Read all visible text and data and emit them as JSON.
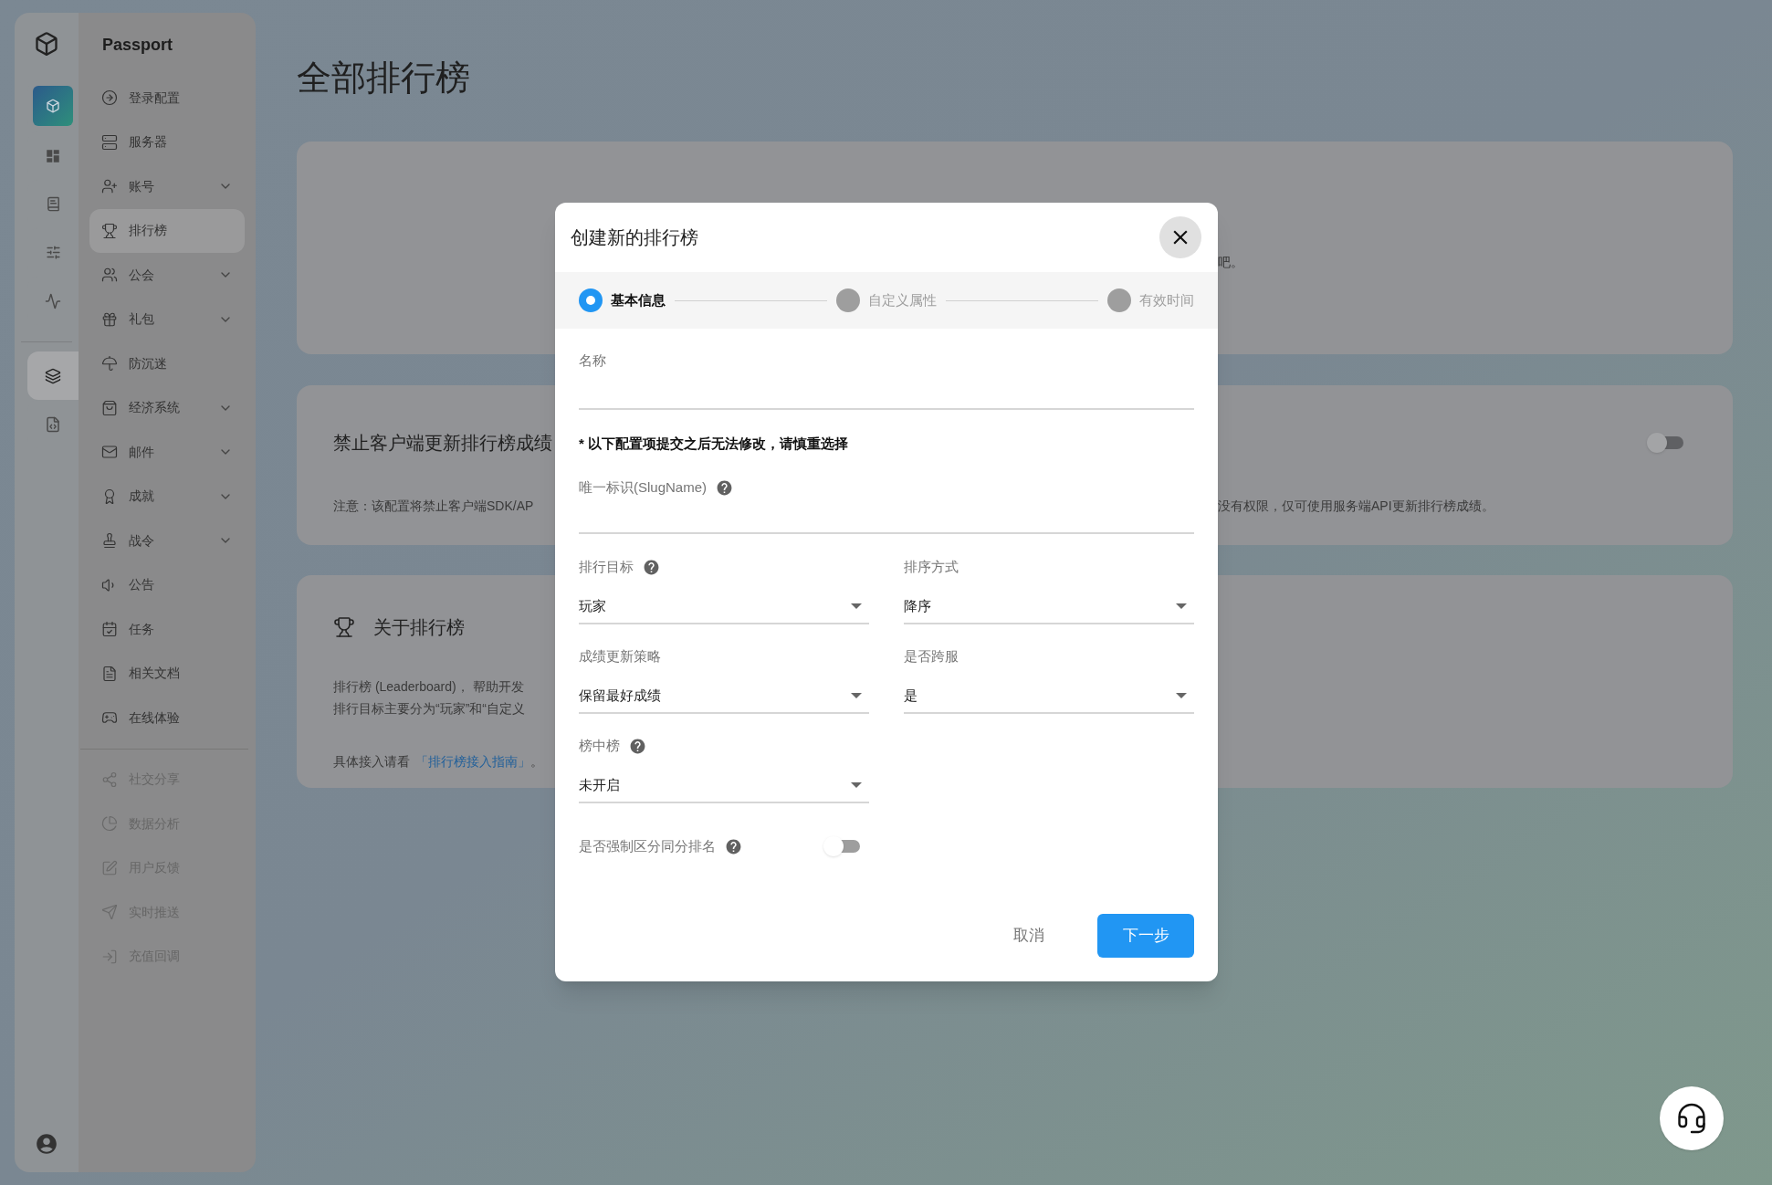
{
  "rail": {
    "items": [
      {
        "kind": "app",
        "selected": false
      },
      {
        "kind": "dashboard",
        "selected": false
      },
      {
        "kind": "docs",
        "selected": false
      },
      {
        "kind": "sliders",
        "selected": false
      },
      {
        "kind": "monitor",
        "selected": false
      },
      {
        "kind": "layers",
        "selected": true
      },
      {
        "kind": "code",
        "selected": false
      }
    ]
  },
  "sidebar": {
    "title": "Passport",
    "sections": [
      {
        "items": [
          {
            "label": "登录配置",
            "selected": false,
            "expandable": false,
            "disabled": false
          },
          {
            "label": "服务器",
            "selected": false,
            "expandable": false,
            "disabled": false
          },
          {
            "label": "账号",
            "selected": false,
            "expandable": true,
            "disabled": false
          },
          {
            "label": "排行榜",
            "selected": true,
            "expandable": false,
            "disabled": false
          },
          {
            "label": "公会",
            "selected": false,
            "expandable": true,
            "disabled": false
          },
          {
            "label": "礼包",
            "selected": false,
            "expandable": true,
            "disabled": false
          },
          {
            "label": "防沉迷",
            "selected": false,
            "expandable": false,
            "disabled": false
          },
          {
            "label": "经济系统",
            "selected": false,
            "expandable": true,
            "disabled": false
          },
          {
            "label": "邮件",
            "selected": false,
            "expandable": true,
            "disabled": false
          },
          {
            "label": "成就",
            "selected": false,
            "expandable": true,
            "disabled": false
          },
          {
            "label": "战令",
            "selected": false,
            "expandable": true,
            "disabled": false
          },
          {
            "label": "公告",
            "selected": false,
            "expandable": false,
            "disabled": false
          },
          {
            "label": "任务",
            "selected": false,
            "expandable": false,
            "disabled": false
          },
          {
            "label": "相关文档",
            "selected": false,
            "expandable": false,
            "disabled": false
          },
          {
            "label": "在线体验",
            "selected": false,
            "expandable": false,
            "disabled": false
          }
        ]
      },
      {
        "items": [
          {
            "label": "社交分享",
            "selected": false,
            "expandable": false,
            "disabled": true
          },
          {
            "label": "数据分析",
            "selected": false,
            "expandable": false,
            "disabled": true
          },
          {
            "label": "用户反馈",
            "selected": false,
            "expandable": false,
            "disabled": true
          },
          {
            "label": "实时推送",
            "selected": false,
            "expandable": false,
            "disabled": true
          },
          {
            "label": "充值回调",
            "selected": false,
            "expandable": false,
            "disabled": true
          }
        ]
      }
    ]
  },
  "page_title": "全部排行榜",
  "intro_card": {
    "text_right": "吧。"
  },
  "client_update_card": {
    "title": "禁止客户端更新排行榜成绩",
    "toggle": {
      "on": false
    },
    "note_left": "注意：该配置将禁止客户端SDK/AP",
    "note_right": "没有权限，仅可使用服务端API更新排行榜成绩。"
  },
  "about_card": {
    "title": "关于排行榜",
    "lines": [
      "排行榜 (Leaderboard)， 帮助开发",
      "排行目标主要分为“玩家”和“自定义"
    ],
    "guide_prefix": "具体接入请看",
    "guide_link": "「排行榜接入指南」",
    "guide_suffix": "。"
  },
  "dialog": {
    "title": "创建新的排行榜",
    "steps": [
      {
        "label": "基本信息",
        "selected": true
      },
      {
        "label": "自定义属性",
        "selected": false
      },
      {
        "label": "有效时间",
        "selected": false
      }
    ],
    "name_field": {
      "label": "名称"
    },
    "warning": "* 以下配置项提交之后无法修改，请慎重选择",
    "slug_field": {
      "label": "唯一标识(SlugName)",
      "help": true
    },
    "selects": [
      {
        "label": "排行目标",
        "value": "玩家",
        "help": true
      },
      {
        "label": "排序方式",
        "value": "降序",
        "help": false
      },
      {
        "label": "成绩更新策略",
        "value": "保留最好成绩",
        "help": false
      },
      {
        "label": "是否跨服",
        "value": "是",
        "help": false
      },
      {
        "label": "榜中榜",
        "value": "未开启",
        "help": true
      }
    ],
    "tie_toggle": {
      "label": "是否强制区分同分排名",
      "help": true,
      "on": false
    },
    "cancel": "取消",
    "next": "下一步"
  }
}
